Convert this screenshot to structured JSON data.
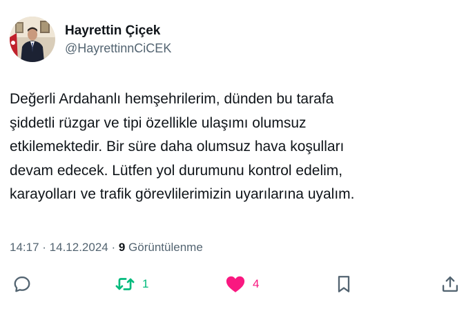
{
  "author": {
    "display_name": "Hayrettin Çiçek",
    "handle": "@HayrettinnCiCEK"
  },
  "tweet": {
    "text": "Değerli Ardahanlı hemşehrilerim, dünden bu tarafa\nşiddetli rüzgar ve tipi özellikle ulaşımı olumsuz\netkilemektedir. Bir süre daha olumsuz hava koşulları\ndevam edecek. Lütfen yol durumunu kontrol edelim,\nkarayolları ve trafik görevlilerimizin uyarılarına uyalım."
  },
  "meta": {
    "time": "14:17",
    "separator1": " · ",
    "date": "14.12.2024",
    "separator2": " · ",
    "views_count": "9",
    "views_label": " Görüntülenme"
  },
  "actions": {
    "reply": {
      "icon": "reply-icon"
    },
    "retweet": {
      "icon": "retweet-icon",
      "count": "1",
      "color": "#00ba7c"
    },
    "like": {
      "icon": "heart-icon",
      "count": "4",
      "color": "#f91880"
    },
    "bookmark": {
      "icon": "bookmark-icon"
    },
    "share": {
      "icon": "share-icon"
    }
  },
  "colors": {
    "text": "#0f1419",
    "secondary": "#536471"
  }
}
